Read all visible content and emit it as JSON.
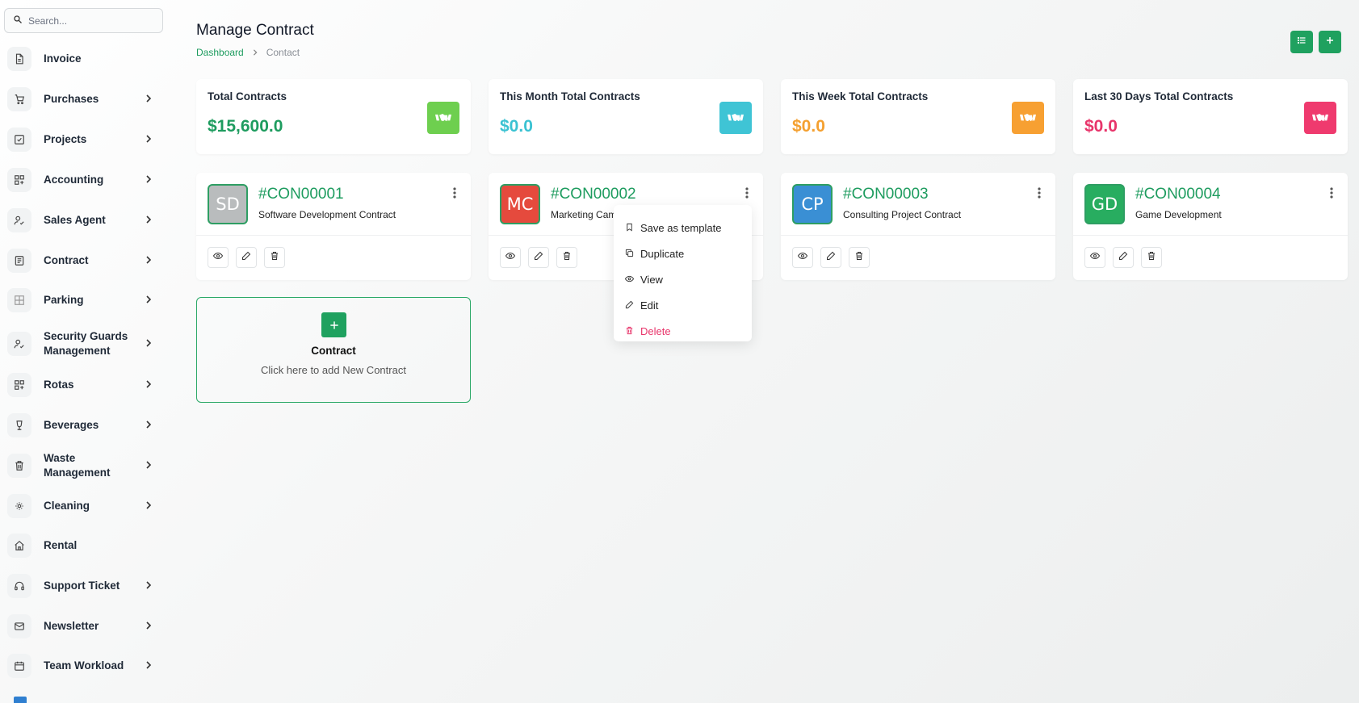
{
  "search": {
    "placeholder": "Search..."
  },
  "sidebar": {
    "items": [
      {
        "label": "Invoice",
        "icon": "file-icon",
        "chevron": false
      },
      {
        "label": "Purchases",
        "icon": "cart-icon",
        "chevron": true
      },
      {
        "label": "Projects",
        "icon": "checkbox-icon",
        "chevron": true
      },
      {
        "label": "Accounting",
        "icon": "grid-icon",
        "chevron": true
      },
      {
        "label": "Sales Agent",
        "icon": "user-check-icon",
        "chevron": true
      },
      {
        "label": "Contract",
        "icon": "contract-icon",
        "chevron": true
      },
      {
        "label": "Parking",
        "icon": "parking-icon",
        "chevron": true
      },
      {
        "label": "Security Guards Management",
        "icon": "user-check-icon",
        "chevron": true
      },
      {
        "label": "Rotas",
        "icon": "grid-icon",
        "chevron": true
      },
      {
        "label": "Beverages",
        "icon": "glass-icon",
        "chevron": true
      },
      {
        "label": "Waste Management",
        "icon": "trash-icon",
        "chevron": true
      },
      {
        "label": "Cleaning",
        "icon": "sun-icon",
        "chevron": true
      },
      {
        "label": "Rental",
        "icon": "home-icon",
        "chevron": false
      },
      {
        "label": "Support Ticket",
        "icon": "headphones-icon",
        "chevron": true
      },
      {
        "label": "Newsletter",
        "icon": "mail-icon",
        "chevron": true
      },
      {
        "label": "Team Workload",
        "icon": "calendar-icon",
        "chevron": true
      }
    ]
  },
  "header": {
    "title": "Manage Contract",
    "breadcrumb": {
      "home": "Dashboard",
      "current": "Contact"
    }
  },
  "stats": [
    {
      "title": "Total Contracts",
      "value": "$15,600.0",
      "color": "#1e9c5f",
      "icon_bg": "#6ecf4f",
      "icon": "handshake-icon"
    },
    {
      "title": "This Month Total Contracts",
      "value": "$0.0",
      "color": "#3bc2d2",
      "icon_bg": "#3fc4d5",
      "icon": "handshake-icon"
    },
    {
      "title": "This Week Total Contracts",
      "value": "$0.0",
      "color": "#f4a030",
      "icon_bg": "#f7a032",
      "icon": "handshake-icon"
    },
    {
      "title": "Last 30 Days Total Contracts",
      "value": "$0.0",
      "color": "#e8356b",
      "icon_bg": "#ef3a6e",
      "icon": "handshake-icon"
    }
  ],
  "contracts": [
    {
      "initials": "SD",
      "code": "#CON00001",
      "name": "Software Development Contract",
      "avatar_bg": "#b9bcbd"
    },
    {
      "initials": "MC",
      "code": "#CON00002",
      "name": "Marketing Cam",
      "avatar_bg": "#e54a3d"
    },
    {
      "initials": "CP",
      "code": "#CON00003",
      "name": "Consulting Project Contract",
      "avatar_bg": "#3a8fd4"
    },
    {
      "initials": "GD",
      "code": "#CON00004",
      "name": "Game Development",
      "avatar_bg": "#28ad60"
    }
  ],
  "add_card": {
    "title": "Contract",
    "subtitle": "Click here to add New Contract"
  },
  "dropdown": {
    "items": [
      {
        "label": "Save as template",
        "icon": "bookmark-icon"
      },
      {
        "label": "Duplicate",
        "icon": "copy-icon"
      },
      {
        "label": "View",
        "icon": "eye-icon"
      },
      {
        "label": "Edit",
        "icon": "pencil-icon"
      },
      {
        "label": "Delete",
        "icon": "trash-icon"
      }
    ]
  },
  "colors": {
    "accent": "#1fa15f",
    "danger": "#e8356b"
  }
}
